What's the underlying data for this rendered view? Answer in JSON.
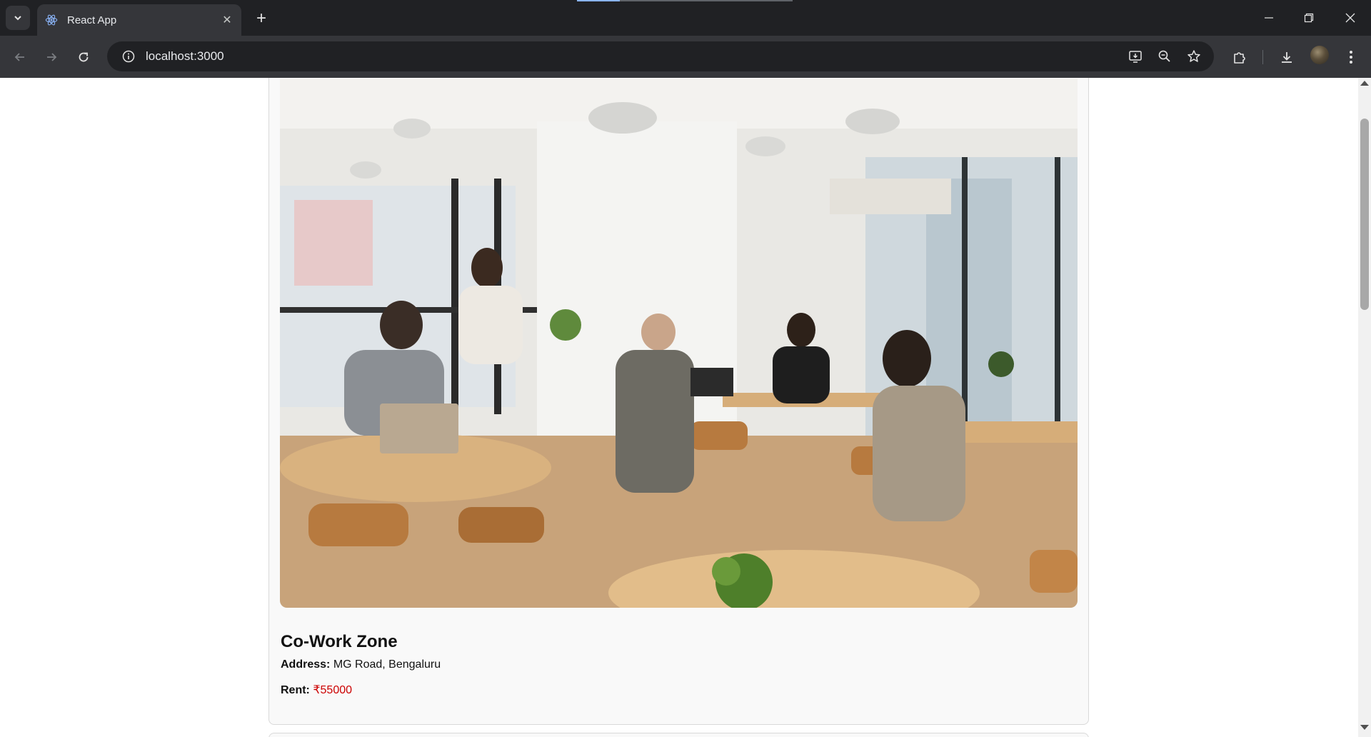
{
  "browser": {
    "tab_title": "React App",
    "url": "localhost:3000",
    "tab_close_glyph": "✕",
    "new_tab_glyph": "+",
    "accent_color": "#8ab4f8"
  },
  "icons": {
    "tab_search": "chevron-down-icon",
    "favicon": "react-icon",
    "back": "arrow-left-icon",
    "forward": "arrow-right-icon",
    "reload": "reload-icon",
    "site_info": "info-icon",
    "install": "install-app-icon",
    "zoom": "zoom-out-icon",
    "bookmark": "star-icon",
    "extensions": "puzzle-icon",
    "downloads": "download-icon",
    "menu": "kebab-menu-icon"
  },
  "listing": {
    "name": "Co-Work Zone",
    "address_label": "Address:",
    "address": "MG Road, Bengaluru",
    "rent_label": "Rent:",
    "rent": "₹55000",
    "rent_color": "#cc0000"
  }
}
